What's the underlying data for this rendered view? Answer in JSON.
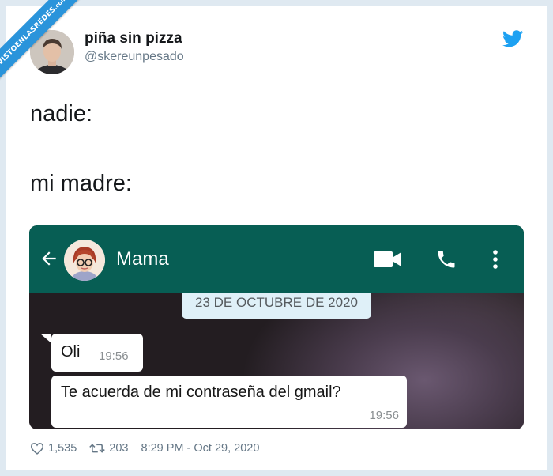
{
  "watermark": {
    "text": "VISTOENLASREDES",
    "suffix": ".com"
  },
  "author": {
    "display_name": "piña sin pizza",
    "handle": "@skereunpesado"
  },
  "tweet": {
    "lines": [
      "nadie:",
      "mi madre:"
    ]
  },
  "embedded": {
    "contact_name": "Mama",
    "date_chip": "23 DE OCTUBRE DE 2020",
    "messages": [
      {
        "text": "Oli",
        "time": "19:56"
      },
      {
        "text": "Te acuerda de mi contraseña del gmail?",
        "time": "19:56"
      }
    ]
  },
  "footer": {
    "likes": "1,535",
    "retweets": "203",
    "timestamp": "8:29 PM - Oct 29, 2020"
  },
  "colors": {
    "twitter_blue": "#1da1f2",
    "whatsapp_green": "#075e54",
    "ribbon": "#2a94db"
  }
}
